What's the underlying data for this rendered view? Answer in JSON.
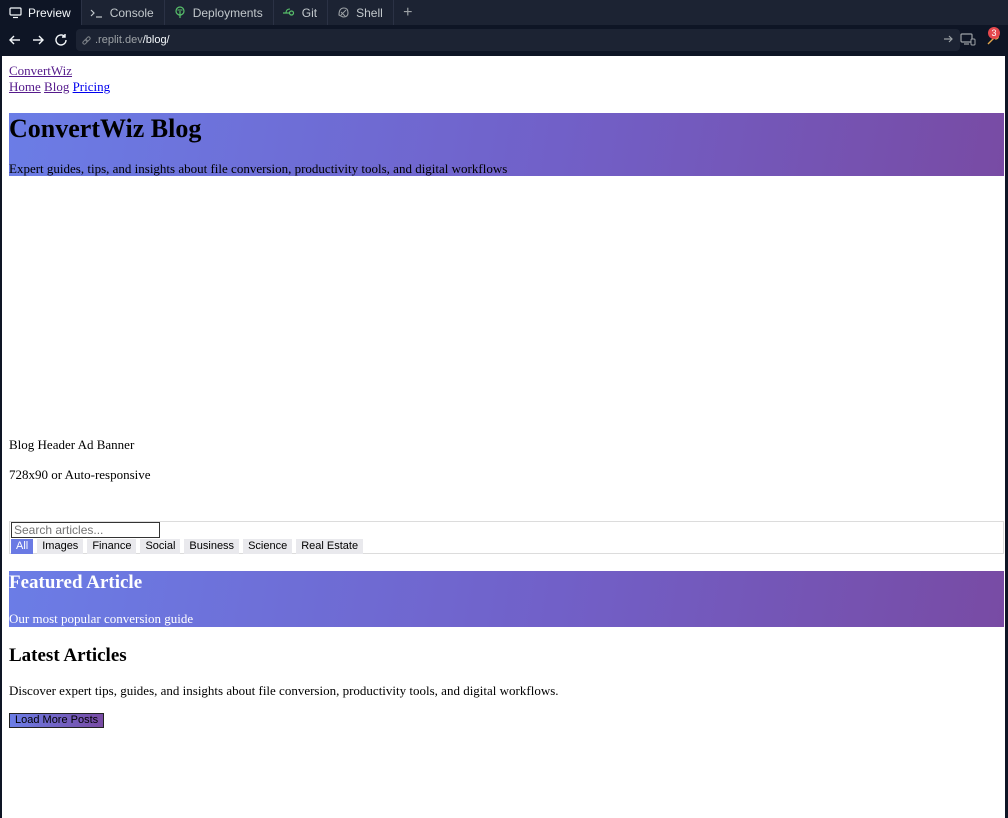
{
  "ide": {
    "tabs": [
      {
        "label": "Preview",
        "icon": "monitor-icon",
        "active": true
      },
      {
        "label": "Console",
        "icon": "terminal-icon",
        "active": false
      },
      {
        "label": "Deployments",
        "icon": "deployments-icon",
        "active": false
      },
      {
        "label": "Git",
        "icon": "git-icon",
        "active": false
      },
      {
        "label": "Shell",
        "icon": "shell-icon",
        "active": false
      }
    ],
    "add_tab_label": "+",
    "url": {
      "host": ".replit.dev",
      "path": "/blog/"
    },
    "notification_count": "3"
  },
  "site": {
    "brand": "ConvertWiz",
    "nav": [
      "Home",
      "Blog",
      "Pricing"
    ],
    "hero": {
      "title": "ConvertWiz Blog",
      "subtitle": "Expert guides, tips, and insights about file conversion, productivity tools, and digital workflows"
    },
    "ad": {
      "title": "Blog Header Ad Banner",
      "size": "728x90 or Auto-responsive"
    },
    "search": {
      "placeholder": "Search articles..."
    },
    "filters": [
      "All",
      "Images",
      "Finance",
      "Social",
      "Business",
      "Science",
      "Real Estate"
    ],
    "active_filter": "All",
    "featured": {
      "title": "Featured Article",
      "subtitle": "Our most popular conversion guide"
    },
    "latest": {
      "title": "Latest Articles",
      "description": "Discover expert tips, guides, and insights about file conversion, productivity tools, and digital workflows."
    },
    "load_more_label": "Load More Posts"
  },
  "colors": {
    "ide_bg": "#0e1525",
    "ide_tabbar": "#1c2333",
    "gradient_start": "#6b7de6",
    "gradient_end": "#784ba4",
    "badge": "#e5484d"
  }
}
